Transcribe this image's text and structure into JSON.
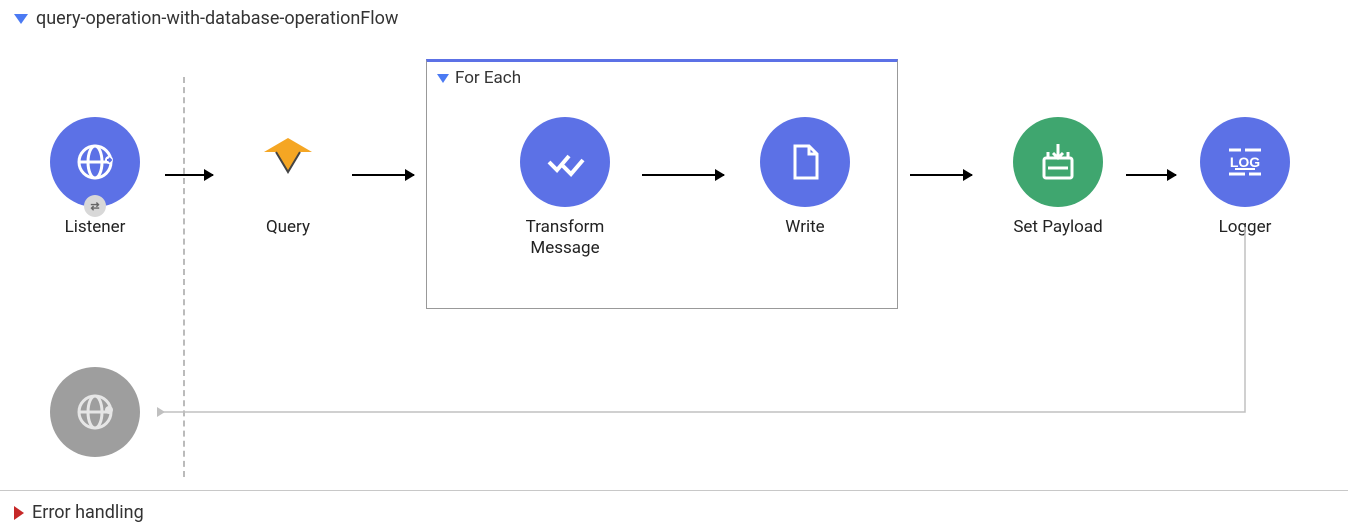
{
  "flow": {
    "title": "query-operation-with-database-operationFlow",
    "for_each_label": "For Each",
    "nodes": {
      "listener": "Listener",
      "query": "Query",
      "transform": "Transform\nMessage",
      "write": "Write",
      "set_payload": "Set Payload",
      "logger": "Logger"
    }
  },
  "error_section": {
    "title": "Error handling"
  },
  "colors": {
    "primary": "#5c71e6",
    "green": "#3fa66f",
    "grey": "#9e9e9e",
    "error": "#c62828"
  }
}
